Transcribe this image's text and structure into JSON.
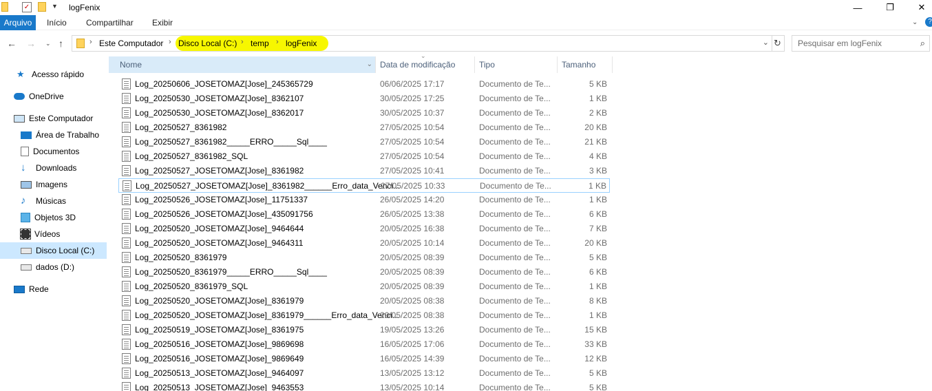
{
  "window": {
    "title": "logFenix",
    "minimize": "—",
    "restore": "❐",
    "close": "✕"
  },
  "ribbon": {
    "tabs": [
      "Arquivo",
      "Início",
      "Compartilhar",
      "Exibir"
    ]
  },
  "address": {
    "crumbs": [
      "Este Computador",
      "Disco Local (C:)",
      "temp",
      "logFenix"
    ],
    "highlight_color": "#f7f700"
  },
  "search": {
    "placeholder": "Pesquisar em logFenix"
  },
  "nav": {
    "items": [
      {
        "label": "Acesso rápido",
        "icon": "star-icon"
      },
      {
        "label": "OneDrive",
        "icon": "cloud-icon"
      },
      {
        "label": "Este Computador",
        "icon": "computer-icon"
      },
      {
        "label": "Área de Trabalho",
        "icon": "desktop-icon"
      },
      {
        "label": "Documentos",
        "icon": "documents-icon"
      },
      {
        "label": "Downloads",
        "icon": "download-icon"
      },
      {
        "label": "Imagens",
        "icon": "images-icon"
      },
      {
        "label": "Músicas",
        "icon": "music-icon"
      },
      {
        "label": "Objetos 3D",
        "icon": "cube-icon"
      },
      {
        "label": "Vídeos",
        "icon": "video-icon"
      },
      {
        "label": "Disco Local (C:)",
        "icon": "drive-icon"
      },
      {
        "label": "dados (D:)",
        "icon": "drive-icon"
      },
      {
        "label": "Rede",
        "icon": "network-icon"
      }
    ]
  },
  "columns": {
    "name": "Nome",
    "date": "Data de modificação",
    "type": "Tipo",
    "size": "Tamanho"
  },
  "files": [
    {
      "name": "Log_20250606_JOSETOMAZ[Jose]_245365729",
      "date": "06/06/2025 17:17",
      "type": "Documento de Te...",
      "size": "5 KB"
    },
    {
      "name": "Log_20250530_JOSETOMAZ[Jose]_8362107",
      "date": "30/05/2025 17:25",
      "type": "Documento de Te...",
      "size": "1 KB"
    },
    {
      "name": "Log_20250530_JOSETOMAZ[Jose]_8362017",
      "date": "30/05/2025 10:37",
      "type": "Documento de Te...",
      "size": "2 KB"
    },
    {
      "name": "Log_20250527_8361982",
      "date": "27/05/2025 10:54",
      "type": "Documento de Te...",
      "size": "20 KB"
    },
    {
      "name": "Log_20250527_8361982_____ERRO_____Sql____",
      "date": "27/05/2025 10:54",
      "type": "Documento de Te...",
      "size": "21 KB"
    },
    {
      "name": "Log_20250527_8361982_SQL",
      "date": "27/05/2025 10:54",
      "type": "Documento de Te...",
      "size": "4 KB"
    },
    {
      "name": "Log_20250527_JOSETOMAZ[Jose]_8361982",
      "date": "27/05/2025 10:41",
      "type": "Documento de Te...",
      "size": "3 KB"
    },
    {
      "name": "Log_20250527_JOSETOMAZ[Jose]_8361982______Erro_data_Venci...",
      "date": "27/05/2025 10:33",
      "type": "Documento de Te...",
      "size": "1 KB"
    },
    {
      "name": "Log_20250526_JOSETOMAZ[Jose]_11751337",
      "date": "26/05/2025 14:20",
      "type": "Documento de Te...",
      "size": "1 KB"
    },
    {
      "name": "Log_20250526_JOSETOMAZ[Jose]_435091756",
      "date": "26/05/2025 13:38",
      "type": "Documento de Te...",
      "size": "6 KB"
    },
    {
      "name": "Log_20250520_JOSETOMAZ[Jose]_9464644",
      "date": "20/05/2025 16:38",
      "type": "Documento de Te...",
      "size": "7 KB"
    },
    {
      "name": "Log_20250520_JOSETOMAZ[Jose]_9464311",
      "date": "20/05/2025 10:14",
      "type": "Documento de Te...",
      "size": "20 KB"
    },
    {
      "name": "Log_20250520_8361979",
      "date": "20/05/2025 08:39",
      "type": "Documento de Te...",
      "size": "5 KB"
    },
    {
      "name": "Log_20250520_8361979_____ERRO_____Sql____",
      "date": "20/05/2025 08:39",
      "type": "Documento de Te...",
      "size": "6 KB"
    },
    {
      "name": "Log_20250520_8361979_SQL",
      "date": "20/05/2025 08:39",
      "type": "Documento de Te...",
      "size": "1 KB"
    },
    {
      "name": "Log_20250520_JOSETOMAZ[Jose]_8361979",
      "date": "20/05/2025 08:38",
      "type": "Documento de Te...",
      "size": "8 KB"
    },
    {
      "name": "Log_20250520_JOSETOMAZ[Jose]_8361979______Erro_data_Venci...",
      "date": "20/05/2025 08:38",
      "type": "Documento de Te...",
      "size": "1 KB"
    },
    {
      "name": "Log_20250519_JOSETOMAZ[Jose]_8361975",
      "date": "19/05/2025 13:26",
      "type": "Documento de Te...",
      "size": "15 KB"
    },
    {
      "name": "Log_20250516_JOSETOMAZ[Jose]_9869698",
      "date": "16/05/2025 17:06",
      "type": "Documento de Te...",
      "size": "33 KB"
    },
    {
      "name": "Log_20250516_JOSETOMAZ[Jose]_9869649",
      "date": "16/05/2025 14:39",
      "type": "Documento de Te...",
      "size": "12 KB"
    },
    {
      "name": "Log_20250513_JOSETOMAZ[Jose]_9464097",
      "date": "13/05/2025 13:12",
      "type": "Documento de Te...",
      "size": "5 KB"
    },
    {
      "name": "Log_20250513_JOSETOMAZ[Jose]_9463553",
      "date": "13/05/2025 10:14",
      "type": "Documento de Te...",
      "size": "5 KB"
    }
  ]
}
